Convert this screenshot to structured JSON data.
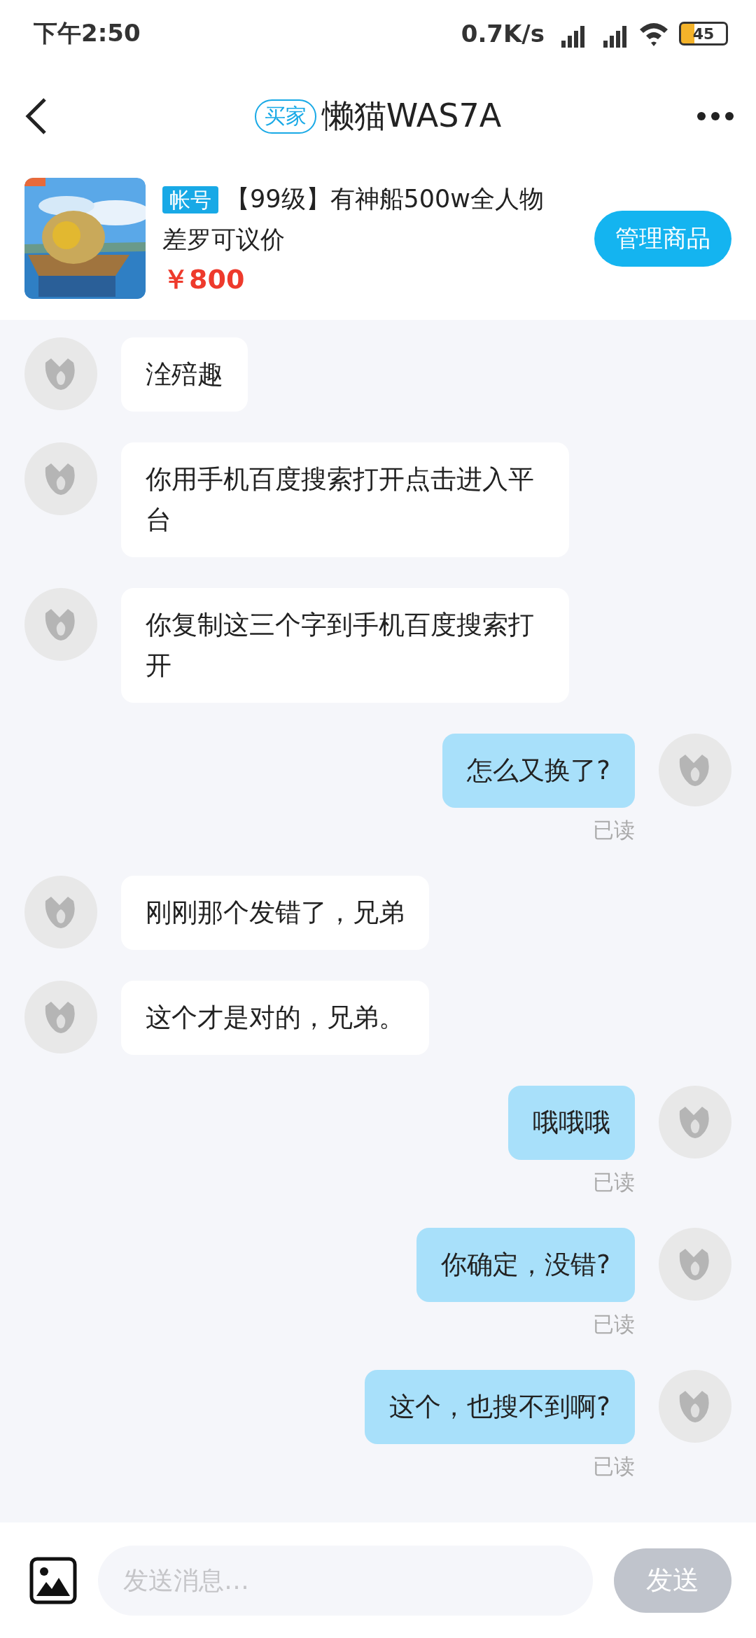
{
  "status_bar": {
    "time": "下午2:50",
    "network_speed": "0.7K/s",
    "battery": "45"
  },
  "header": {
    "badge": "买家",
    "title": "懒猫WAS7A"
  },
  "product": {
    "tag": "帐号",
    "title": "【99级】有神船500w全人物差罗可议价",
    "price": "￥800",
    "button": "管理商品"
  },
  "messages": [
    {
      "kind": "received",
      "text": "洤殕趣"
    },
    {
      "kind": "received",
      "text": "你用手机百度搜索打开点击进入平台"
    },
    {
      "kind": "received",
      "text": "你复制这三个字到手机百度搜索打开"
    },
    {
      "kind": "sent",
      "text": "怎么又换了?",
      "receipt": "已读"
    },
    {
      "kind": "received",
      "text": "刚刚那个发错了，兄弟"
    },
    {
      "kind": "received",
      "text": "这个才是对的，兄弟。"
    },
    {
      "kind": "sent",
      "text": "哦哦哦",
      "receipt": "已读"
    },
    {
      "kind": "sent",
      "text": "你确定，没错?",
      "receipt": "已读"
    },
    {
      "kind": "sent",
      "text": "这个，也搜不到啊?",
      "receipt": "已读"
    }
  ],
  "composer": {
    "placeholder": "发送消息…",
    "send_button": "发送"
  }
}
